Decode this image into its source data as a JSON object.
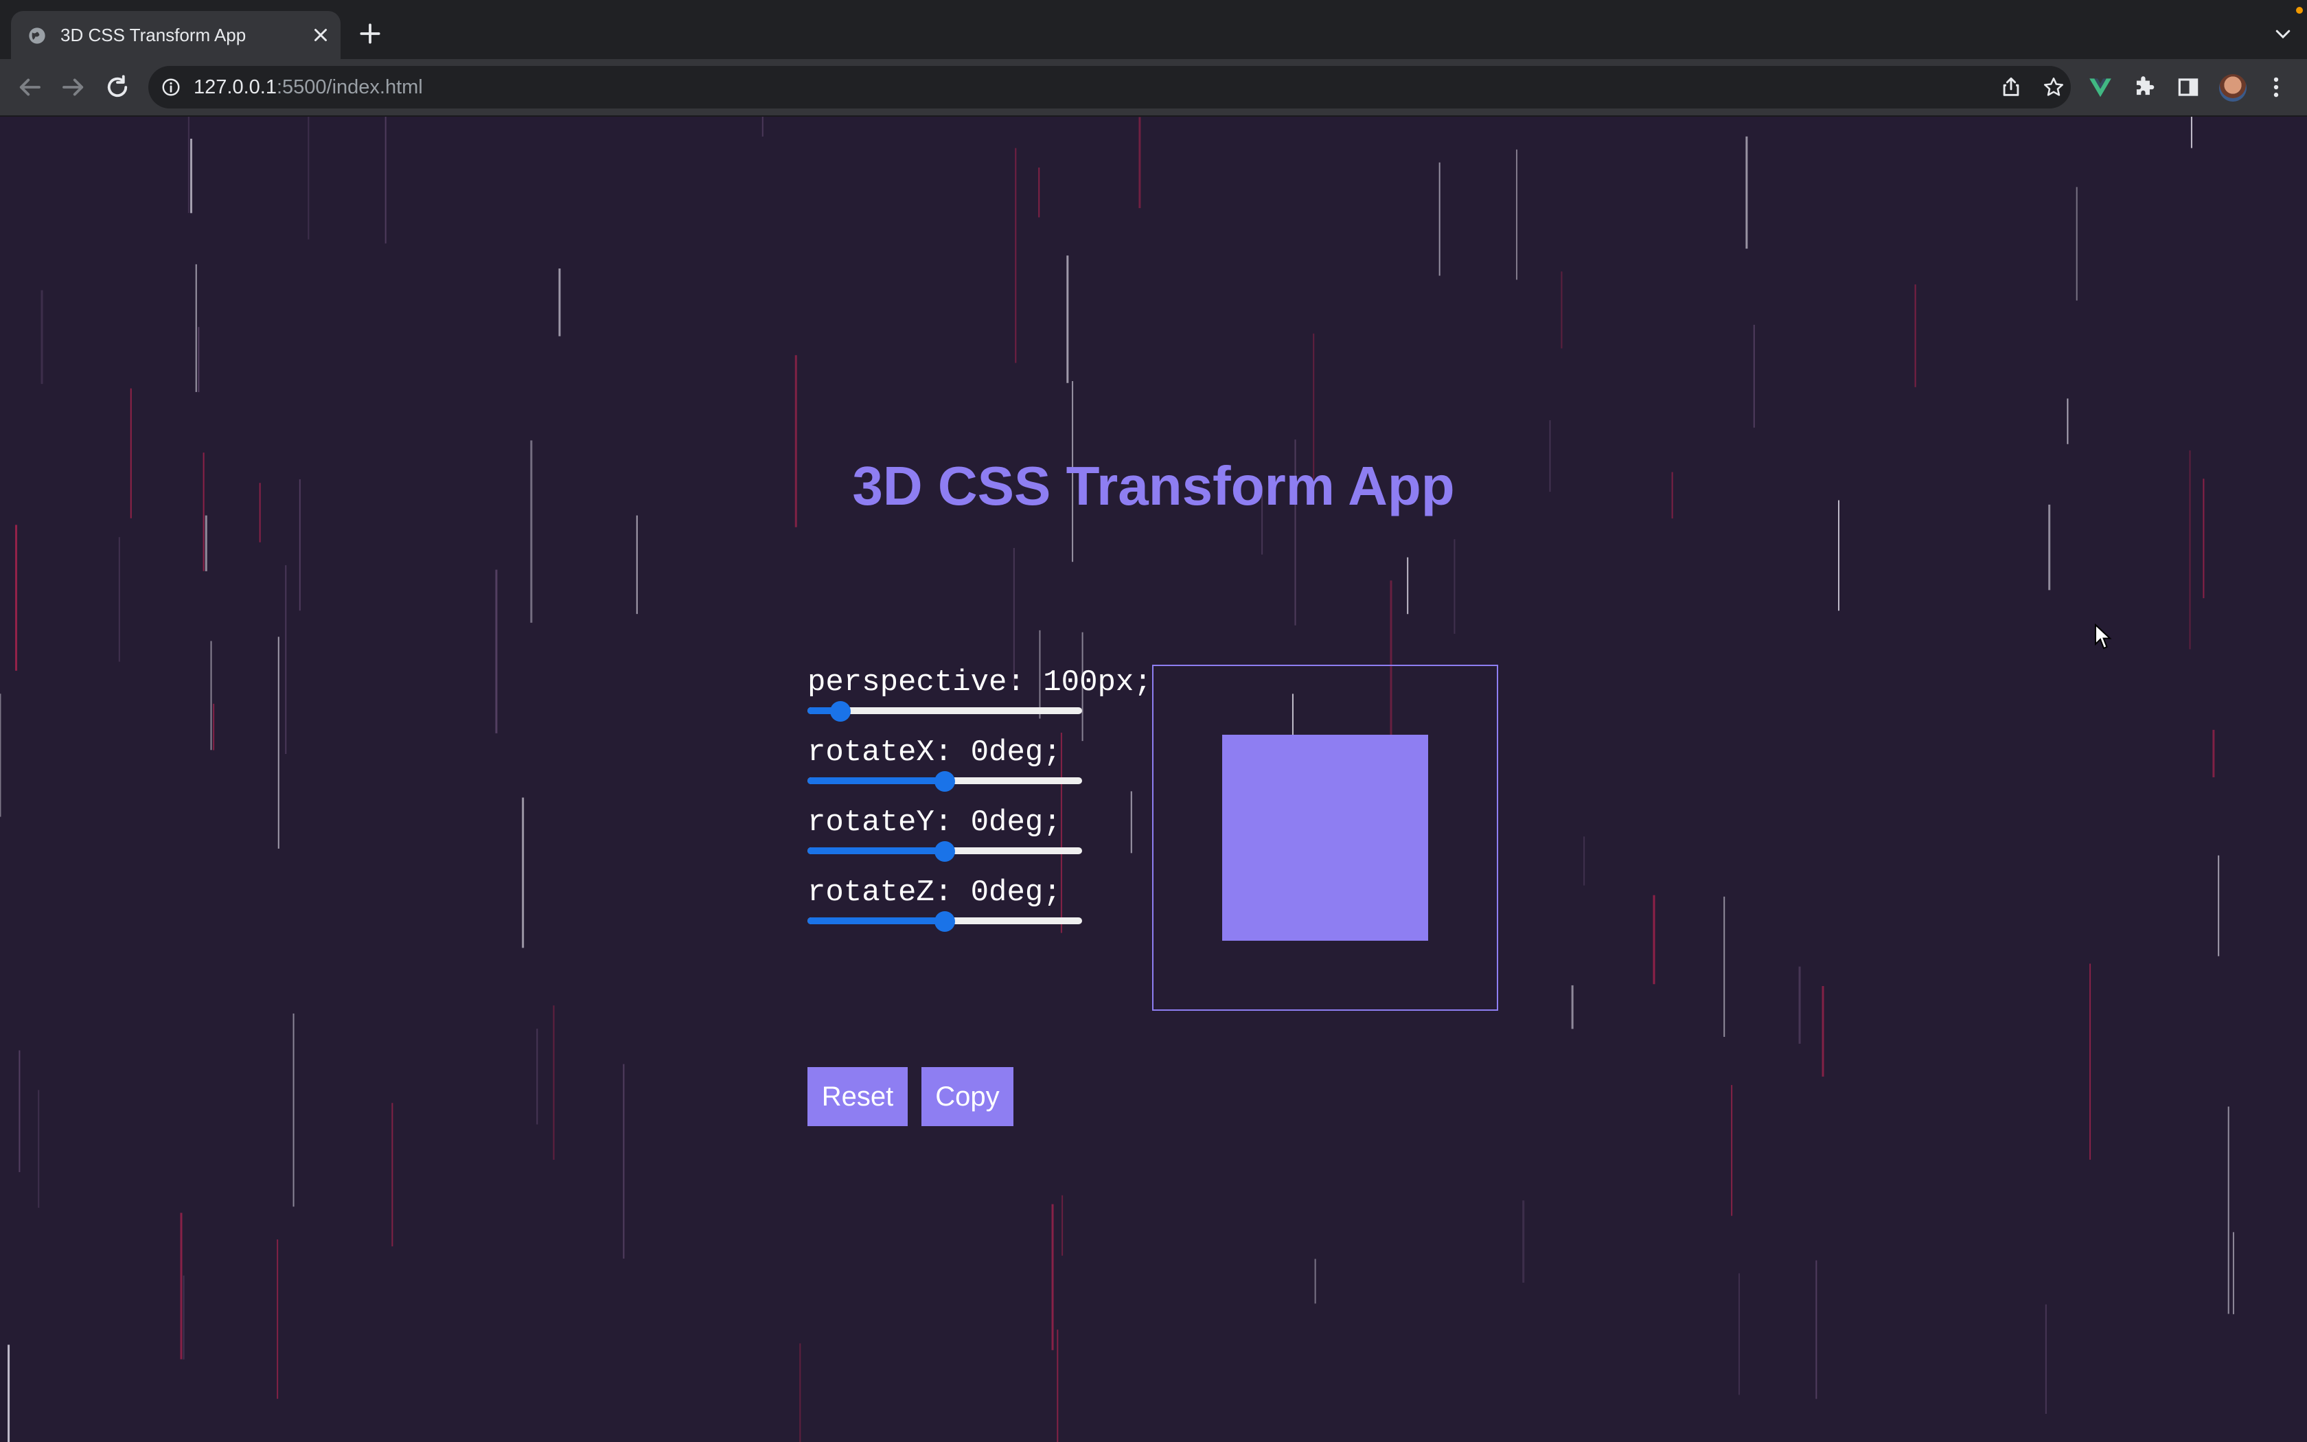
{
  "browser": {
    "tab_title": "3D CSS Transform App",
    "url_host": "127.0.0.1",
    "url_rest": ":5500/index.html"
  },
  "app": {
    "title": "3D CSS Transform App",
    "controls": [
      {
        "label": "perspective: 100px;",
        "value_fraction": 0.12
      },
      {
        "label": "rotateX: 0deg;",
        "value_fraction": 0.5
      },
      {
        "label": "rotateY: 0deg;",
        "value_fraction": 0.5
      },
      {
        "label": "rotateZ: 0deg;",
        "value_fraction": 0.5
      }
    ],
    "reset_label": "Reset",
    "copy_label": "Copy"
  },
  "colors": {
    "background": "#251c33",
    "accent": "#8e7ef2",
    "slider": "#1a73e8"
  }
}
